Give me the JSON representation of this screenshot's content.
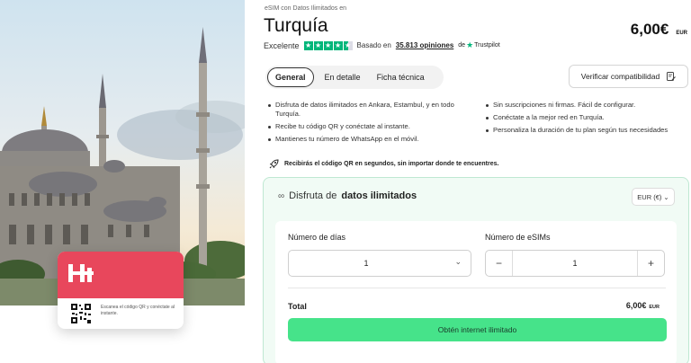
{
  "hero": {
    "card_note": "Escanea el código QR y conéctate al instante."
  },
  "header": {
    "breadcrumb": "eSIM con Datos Ilimitados en",
    "title": "Turquía",
    "price": "6,00€",
    "currency": "EUR"
  },
  "rating": {
    "label": "Excelente",
    "stars": 4.5,
    "based_on": "Basado en",
    "count": "35.813 opiniones",
    "de": "de",
    "provider": "Trustpilot"
  },
  "tabs": [
    {
      "label": "General",
      "active": true
    },
    {
      "label": "En detalle",
      "active": false
    },
    {
      "label": "Ficha técnica",
      "active": false
    }
  ],
  "compat_button": "Verificar compatibilidad",
  "features_left": [
    "Disfruta de datos ilimitados en Ankara, Estambul, y en todo Turquía.",
    "Recibe tu código QR y conéctate al instante.",
    "Mantienes tu número de WhatsApp en el móvil."
  ],
  "features_right": [
    "Sin suscripciones ni firmas. Fácil de configurar.",
    "Conéctate a la mejor red en Turquía.",
    "Personaliza la duración de tu plan según tus necesidades"
  ],
  "notice": "Recibirás el código QR en segundos, sin importar donde te encuentres.",
  "plan": {
    "heading_prefix": "Disfruta de",
    "heading_bold": "datos ilimitados",
    "currency_select": "EUR (€)",
    "days_label": "Número de días",
    "days_value": "1",
    "esims_label": "Número de eSIMs",
    "esims_value": "1",
    "total_label": "Total",
    "total_value": "6,00€",
    "total_currency": "EUR",
    "cta": "Obtén internet ilimitado"
  },
  "colors": {
    "brand_red": "#e8475c",
    "cta_green": "#46e38a",
    "trustpilot_green": "#00b67a"
  }
}
